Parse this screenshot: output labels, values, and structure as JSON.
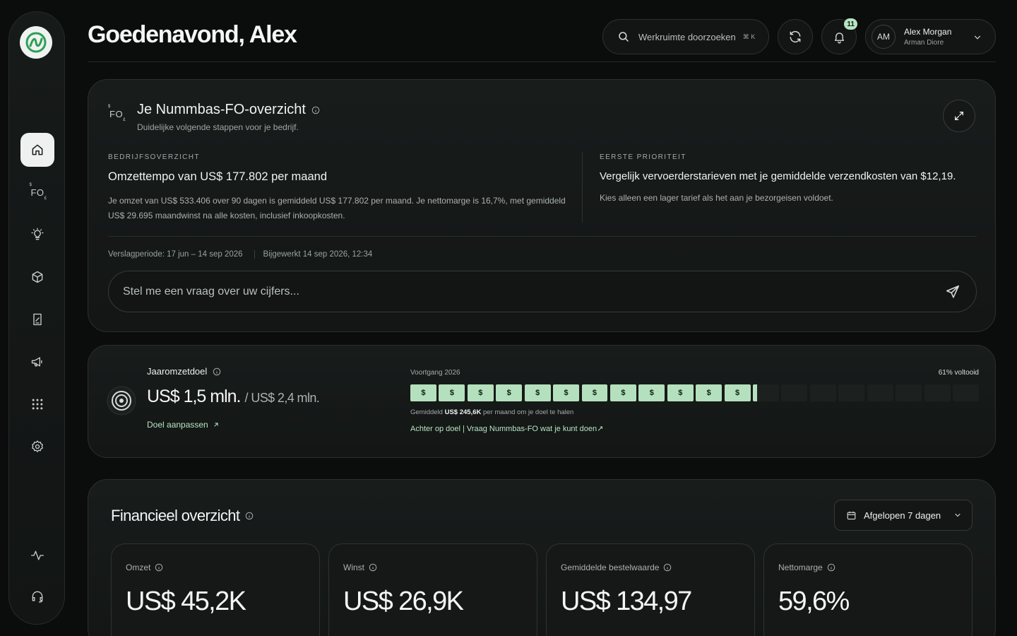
{
  "header": {
    "greeting": "Goedenavond, Alex",
    "search_placeholder": "Werkruimte doorzoeken",
    "search_shortcut": "⌘ K",
    "notifications_count": "11",
    "user_name": "Alex Morgan",
    "user_org": "Arman Diore",
    "user_initials": "AM"
  },
  "sidebar": {
    "items": [
      {
        "name": "home-icon",
        "active": true
      },
      {
        "name": "fo-icon",
        "label": "FO"
      },
      {
        "name": "lightbulb-icon"
      },
      {
        "name": "box-icon"
      },
      {
        "name": "report-icon"
      },
      {
        "name": "megaphone-icon"
      },
      {
        "name": "apps-grid-icon"
      },
      {
        "name": "settings-icon"
      },
      {
        "name": "activity-icon"
      },
      {
        "name": "headset-icon"
      }
    ]
  },
  "overview": {
    "title": "Je Nummbas-FO-overzicht",
    "subtitle": "Duidelijke volgende stappen voor je bedrijf.",
    "left": {
      "kicker": "BEDRIJFSOVERZICHT",
      "headline": "Omzettempo van US$ 177.802 per maand",
      "body": "Je omzet van US$ 533.406 over 90 dagen is gemiddeld US$ 177.802 per maand. Je nettomarge is 16,7%, met gemiddeld US$ 29.695 maandwinst na alle kosten, inclusief inkoopkosten."
    },
    "right": {
      "kicker": "EERSTE PRIORITEIT",
      "headline": "Vergelijk vervoerderstarieven met je gemiddelde verzendkosten van $12,19.",
      "body": "Kies alleen een lager tarief als het aan je bezorgeisen voldoet."
    },
    "period": "Verslagperiode: 17 jun – 14 sep 2026",
    "updated": "Bijgewerkt 14 sep 2026, 12:34",
    "ask_placeholder": "Stel me een vraag over uw cijfers..."
  },
  "goal": {
    "label": "Jaaromzetdoel",
    "value": "US$ 1,5 mln.",
    "total": "/ US$ 2,4 mln.",
    "adjust_link": "Doel aanpassen",
    "progress_label": "Voortgang 2026",
    "progress_pct_label": "61% voltooid",
    "progress_fraction": 0.61,
    "segments_total": 20,
    "segments_filled": 12,
    "segment_symbol": "$",
    "note_prefix": "Gemiddeld",
    "note_value": "US$ 245,6K",
    "note_suffix": "per maand om je doel te halen",
    "behind_link": "Achter op doel | Vraag Nummbas-FO wat je kunt doen↗"
  },
  "financial": {
    "title": "Financieel overzicht",
    "range": "Afgelopen 7 dagen",
    "metrics": [
      {
        "label": "Omzet",
        "value": "US$ 45,2K"
      },
      {
        "label": "Winst",
        "value": "US$ 26,9K"
      },
      {
        "label": "Gemiddelde bestelwaarde",
        "value": "US$ 134,97"
      },
      {
        "label": "Nettomarge",
        "value": "59,6%"
      }
    ]
  },
  "colors": {
    "accent": "#b5e0bd",
    "background": "#0b0c0c"
  }
}
